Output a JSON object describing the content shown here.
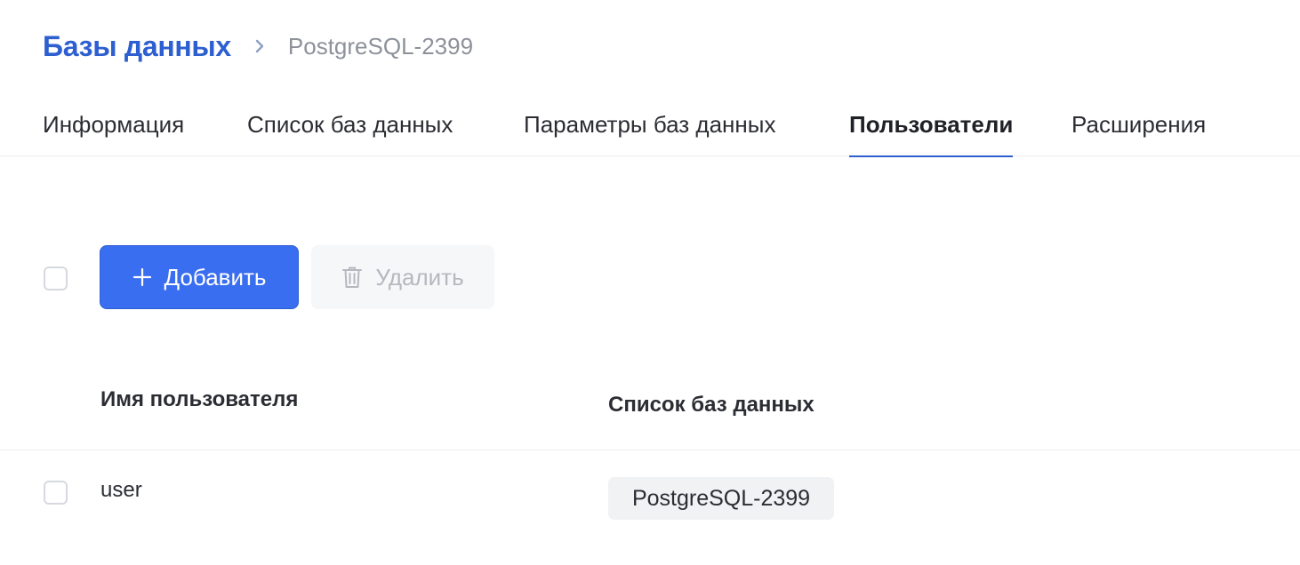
{
  "breadcrumb": {
    "root": "Базы данных",
    "current": "PostgreSQL-2399",
    "separator_icon": "chevron-right-icon"
  },
  "tabs": [
    {
      "label": "Информация",
      "active": false
    },
    {
      "label": "Список баз данных",
      "active": false
    },
    {
      "label": "Параметры баз данных",
      "active": false
    },
    {
      "label": "Пользователи",
      "active": true
    },
    {
      "label": "Расширения",
      "active": false
    }
  ],
  "toolbar": {
    "add_label": "Добавить",
    "add_icon": "plus-icon",
    "delete_label": "Удалить",
    "delete_icon": "trash-icon",
    "delete_disabled": true
  },
  "table": {
    "columns": [
      "Имя пользователя",
      "Список баз данных"
    ],
    "rows": [
      {
        "username": "user",
        "databases": [
          "PostgreSQL-2399"
        ]
      }
    ]
  },
  "colors": {
    "accent": "#2d5fd0",
    "button_primary": "#3a6ef0",
    "muted_text": "#8d9199"
  }
}
